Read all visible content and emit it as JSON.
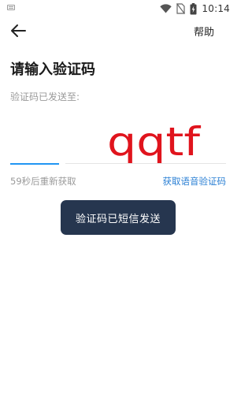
{
  "status_bar": {
    "time": "10:14",
    "icons": [
      "keyboard-icon",
      "wifi-icon",
      "no-sim-icon",
      "battery-charging-icon"
    ]
  },
  "header": {
    "back_icon": "arrow-left-icon",
    "help_label": "帮助"
  },
  "page": {
    "title": "请输入验证码",
    "subtitle": "验证码已发送至:"
  },
  "code_input": {
    "value": "",
    "captcha_text": "qqtf",
    "accent_color": "#2196f3"
  },
  "actions": {
    "countdown_text": "59秒后重新获取",
    "voice_code_label": "获取语音验证码",
    "link_color": "#2a7fd4"
  },
  "toast": {
    "message": "验证码已短信发送",
    "background": "#26364f"
  }
}
